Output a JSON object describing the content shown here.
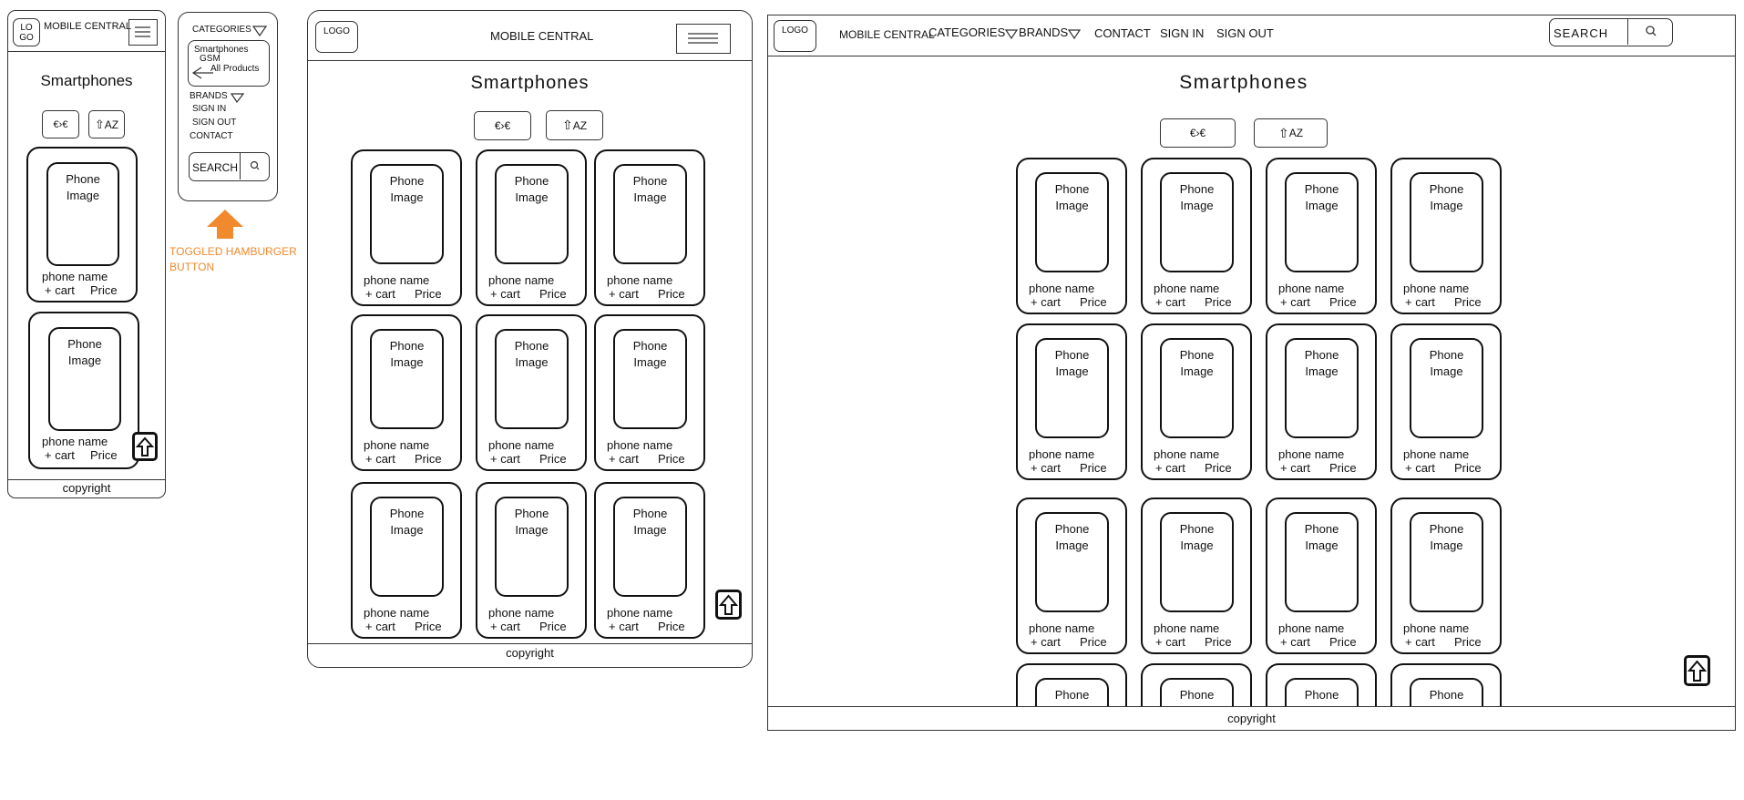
{
  "common": {
    "logo": "LOGO",
    "logo_mobile": "LO GO",
    "brand": "MOBILE CENTRAL",
    "title": "Smartphones",
    "sort_price": "€›€",
    "sort_az": "AZ",
    "copyright": "copyright"
  },
  "card": {
    "image": "Phone Image",
    "name": "phone name",
    "cart": "+ cart",
    "price": "Price"
  },
  "menu": {
    "categories": "CATEGORIES",
    "sub_smartphones": "Smartphones",
    "sub_gsm": "GSM",
    "sub_all": "All Products",
    "brands": "BRANDS",
    "sign_in": "SIGN IN",
    "sign_out": "SIGN OUT",
    "contact": "CONTACT",
    "search": "SEARCH"
  },
  "note": {
    "line1": "TOGGLED HAMBURGER",
    "line2": "BUTTON",
    "color": "#f08a2c"
  },
  "desktop_nav": {
    "categories": "CATEGORIES",
    "brands": "BRANDS",
    "contact": "CONTACT",
    "sign_in": "SIGN IN",
    "sign_out": "SIGN OUT",
    "search": "SEARCH"
  }
}
